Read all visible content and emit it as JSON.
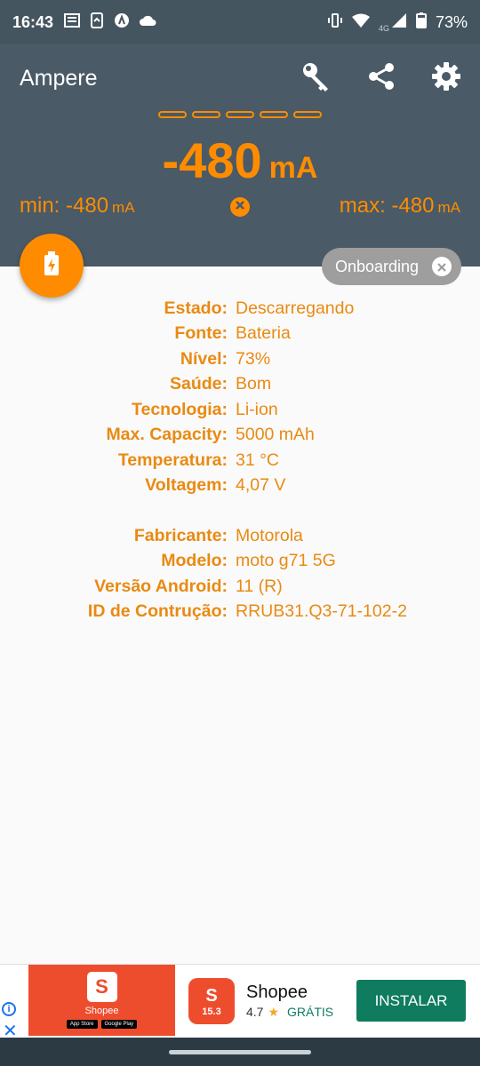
{
  "status_bar": {
    "time": "16:43",
    "battery_percent": "73%",
    "network": "4G"
  },
  "app_bar": {
    "title": "Ampere",
    "actions": [
      "key-icon",
      "share-icon",
      "settings-icon"
    ]
  },
  "current": {
    "value": "-480",
    "unit": "mA"
  },
  "min": {
    "label": "min: -480",
    "unit": "mA"
  },
  "max": {
    "label": "max: -480",
    "unit": "mA"
  },
  "chip": {
    "label": "Onboarding"
  },
  "battery_info": [
    {
      "label": "Estado:",
      "value": "Descarregando"
    },
    {
      "label": "Fonte:",
      "value": "Bateria"
    },
    {
      "label": "Nível:",
      "value": "73%"
    },
    {
      "label": "Saúde:",
      "value": "Bom"
    },
    {
      "label": "Tecnologia:",
      "value": "Li-ion"
    },
    {
      "label": "Max. Capacity:",
      "value": "5000 mAh"
    },
    {
      "label": "Temperatura:",
      "value": "31 °C"
    },
    {
      "label": "Voltagem:",
      "value": "4,07 V"
    }
  ],
  "device_info": [
    {
      "label": "Fabricante:",
      "value": "Motorola"
    },
    {
      "label": "Modelo:",
      "value": "moto g71 5G"
    },
    {
      "label": "Versão Android:",
      "value": "11 (R)"
    },
    {
      "label": "ID de Contrução:",
      "value": "RRUB31.Q3-71-102-2"
    }
  ],
  "ad": {
    "banner_brand": "Shopee",
    "banner_store_1": "App Store",
    "banner_store_2": "Google Play",
    "icon_letter": "S",
    "icon_badge": "15.3",
    "app_name": "Shopee",
    "rating": "4.7",
    "price": "GRÁTIS",
    "install_label": "INSTALAR"
  },
  "colors": {
    "accent": "#ff8c00",
    "app_bar": "#4a5a66",
    "status_bar": "#455560",
    "label_orange": "#e98a12",
    "ad_green": "#0f7b5f"
  }
}
